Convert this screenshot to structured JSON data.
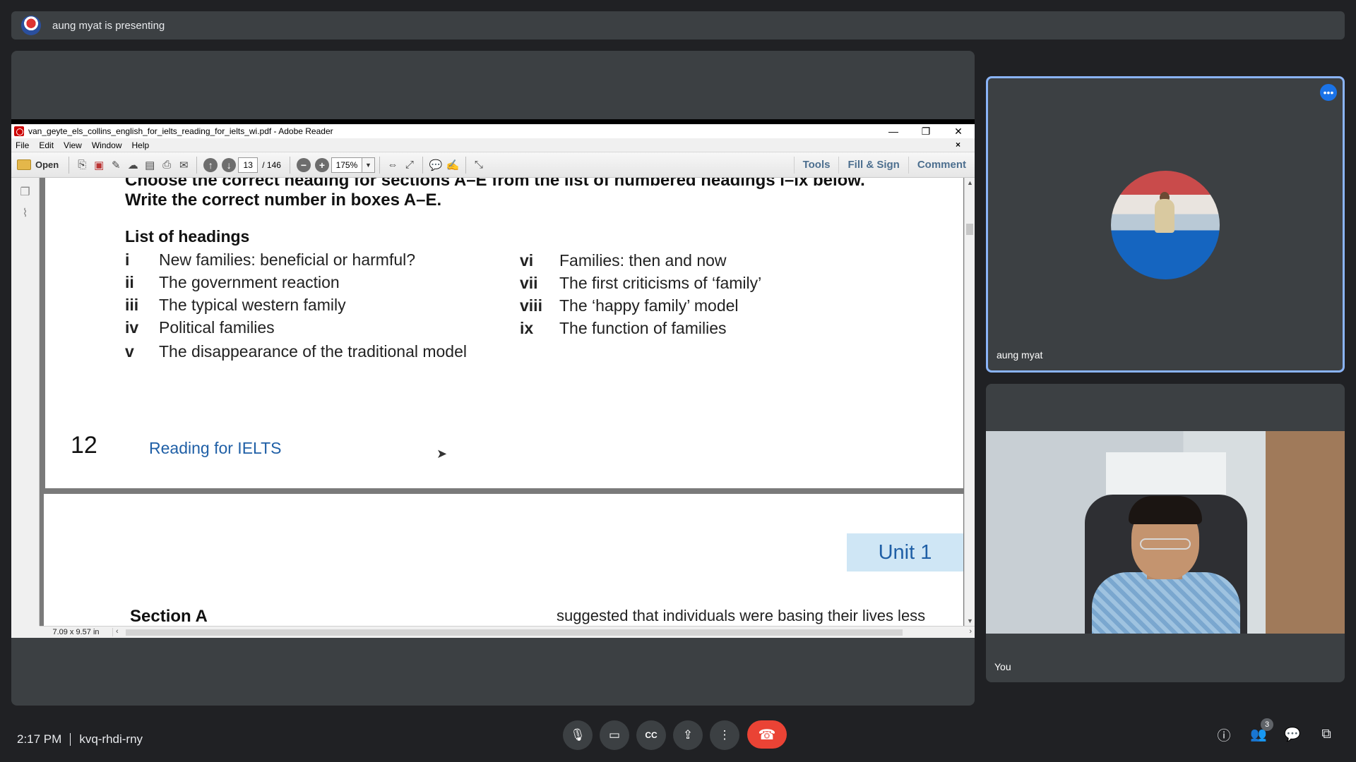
{
  "presenting_bar": {
    "text": "aung myat is presenting"
  },
  "reader": {
    "window_title": "van_geyte_els_collins_english_for_ielts_reading_for_ielts_wi.pdf - Adobe Reader",
    "window_controls": {
      "minimize": "—",
      "restore": "❐",
      "close": "✕"
    },
    "menu": [
      "File",
      "Edit",
      "View",
      "Window",
      "Help"
    ],
    "menu_close": "×",
    "toolbar": {
      "open_label": "Open",
      "page_current": "13",
      "page_total": "/ 146",
      "zoom": "175%",
      "right_tabs": [
        "Tools",
        "Fill & Sign",
        "Comment"
      ]
    },
    "page_size": "7.09 x 9.57 in"
  },
  "document": {
    "instruction_line1": "Choose the correct heading for sections A–E from the list of numbered headings i–ix below.",
    "instruction_line2": "Write the correct number in boxes A–E.",
    "list_title": "List of headings",
    "headings_left": [
      {
        "num": "i",
        "text": "New families: beneficial or harmful?"
      },
      {
        "num": "ii",
        "text": "The government reaction"
      },
      {
        "num": "iii",
        "text": "The typical western family"
      },
      {
        "num": "iv",
        "text": "Political families"
      },
      {
        "num": "v",
        "text": "The disappearance of the traditional model"
      }
    ],
    "headings_right": [
      {
        "num": "vi",
        "text": "Families: then and now"
      },
      {
        "num": "vii",
        "text": "The first criticisms of ‘family’"
      },
      {
        "num": "viii",
        "text": "The ‘happy family’ model"
      },
      {
        "num": "ix",
        "text": "The function of families"
      }
    ],
    "page_number": "12",
    "book_title": "Reading for IELTS",
    "unit_tab": "Unit 1",
    "section_label": "Section A",
    "section_text": "suggested that individuals were basing their lives less"
  },
  "tiles": {
    "presenter_name": "aung myat",
    "self_name": "You",
    "more_options": "•••"
  },
  "bottom_bar": {
    "time": "2:17 PM",
    "meeting_code": "kvq-rhdi-rny",
    "participants_count": "3"
  },
  "colors": {
    "accent_blue": "#8ab4f8",
    "end_call_red": "#ea4335",
    "meet_bg": "#202124",
    "tile_bg": "#3c4043"
  }
}
